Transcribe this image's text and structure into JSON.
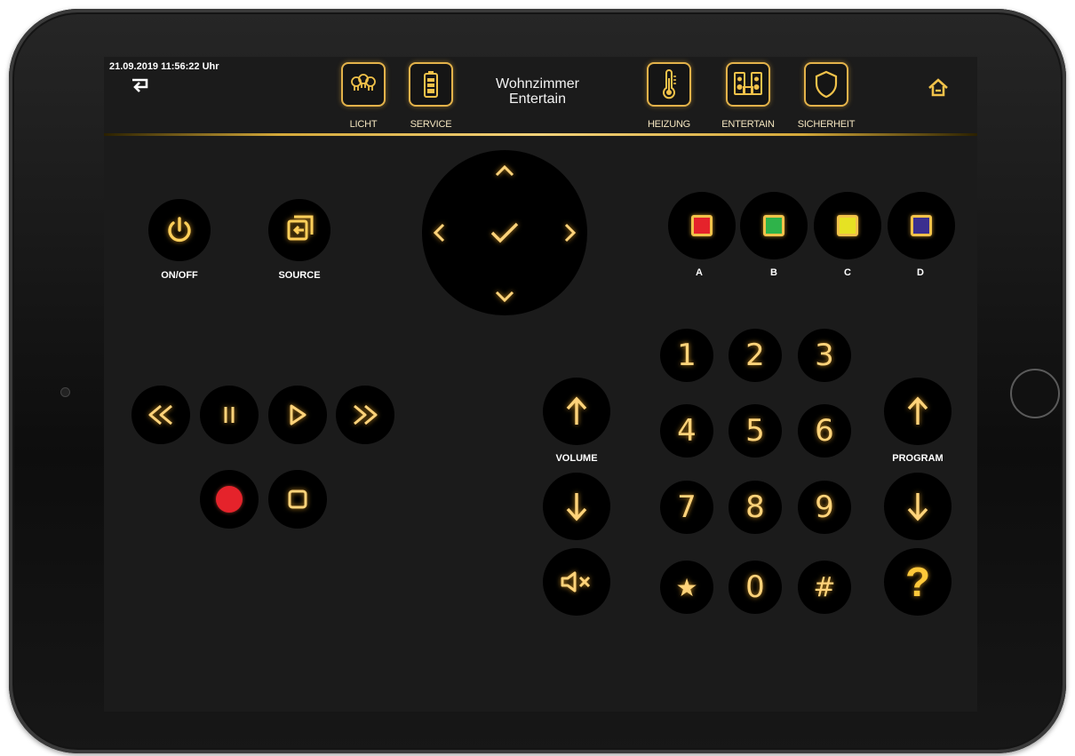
{
  "header": {
    "datetime": "21.09.2019 11:56:22 Uhr",
    "room_line1": "Wohnzimmer",
    "room_line2": "Entertain",
    "nav": [
      {
        "label": "LICHT",
        "icon": "bulbs-icon"
      },
      {
        "label": "SERVICE",
        "icon": "battery-icon"
      },
      {
        "label": "HEIZUNG",
        "icon": "thermometer-icon"
      },
      {
        "label": "ENTERTAIN",
        "icon": "speakers-icon"
      },
      {
        "label": "SICHERHEIT",
        "icon": "shield-icon"
      }
    ]
  },
  "controls": {
    "power_label": "ON/OFF",
    "source_label": "SOURCE",
    "volume_label": "VOLUME",
    "program_label": "PROGRAM"
  },
  "color_buttons": [
    {
      "label": "A",
      "color": "#e5232b"
    },
    {
      "label": "B",
      "color": "#2fb34a"
    },
    {
      "label": "C",
      "color": "#e6e223"
    },
    {
      "label": "D",
      "color": "#3b2f8f"
    }
  ],
  "numpad": [
    "1",
    "2",
    "3",
    "4",
    "5",
    "6",
    "7",
    "8",
    "9",
    "★",
    "0",
    "#"
  ],
  "help_label": "?",
  "colors": {
    "accent_gold": "#f1c24a",
    "record_red": "#e5232b",
    "screen_bg": "#1b1b1b"
  }
}
